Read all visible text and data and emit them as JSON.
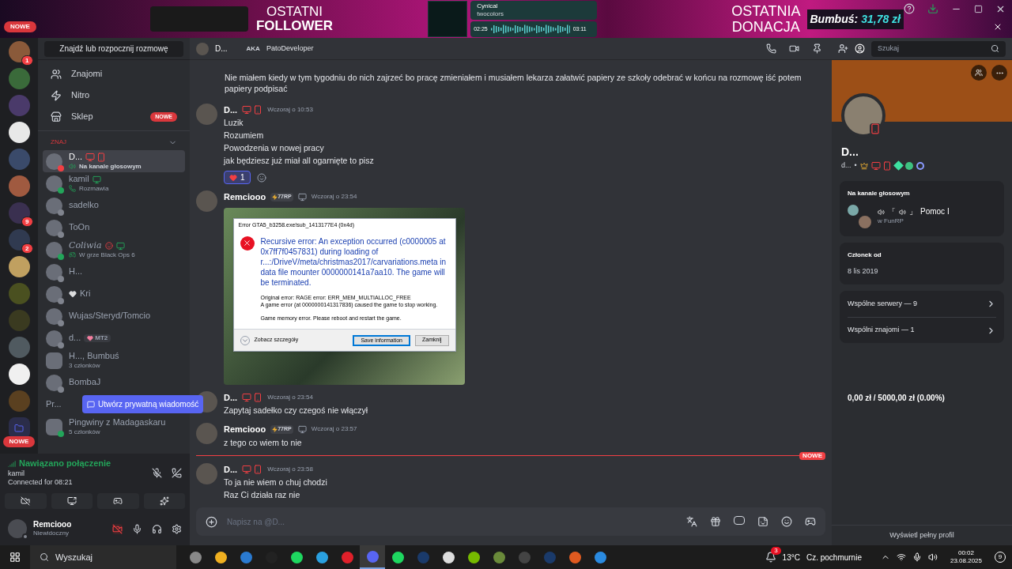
{
  "overlay": {
    "follower_top": "OSTATNI",
    "follower_bottom": "FOLLOWER",
    "track": {
      "title": "Cynical",
      "artist": "twocolors",
      "elapsed": "02:25",
      "total": "03:11"
    },
    "donation_top": "OSTATNIA",
    "donation_bottom": "DONACJA",
    "donor": "Bumbuś:",
    "amount": "31,78 zł"
  },
  "notice": {
    "badge": "NOWE"
  },
  "server_rail": {
    "servers": [
      {
        "badge": "1",
        "color": "#8a5a3a"
      },
      {
        "color": "#3a6a3a"
      },
      {
        "color": "#4a3a6a"
      },
      {
        "color": "#e8e8e8"
      },
      {
        "color": "#3a4a6a"
      },
      {
        "color": "#a05a40"
      },
      {
        "badge": "9",
        "color": "#3a3050"
      },
      {
        "badge": "2",
        "color": "#303a50"
      },
      {
        "color": "#c0a060"
      },
      {
        "color": "#4a5020"
      },
      {
        "color": "#3a3a20"
      },
      {
        "color": "#505a60"
      },
      {
        "color": "#f0f0f0"
      },
      {
        "color": "#5a4020"
      }
    ],
    "folder_badge": "NOWE"
  },
  "dm_sidebar": {
    "search": "Znajdź lub rozpocznij rozmowę",
    "nav": [
      {
        "label": "Znajomi"
      },
      {
        "label": "Nitro"
      },
      {
        "label": "Sklep",
        "badge": "NOWE"
      }
    ],
    "section": "ZNAJ",
    "dms": [
      {
        "kind": "voice",
        "name": "D...",
        "status": "Na kanale głosowym",
        "color": "#f23f43",
        "devices": true,
        "selected": true
      },
      {
        "kind": "call",
        "name": "kamil",
        "status": "Rozmawia",
        "color": "#23a55a",
        "desktop": true,
        "selected": false
      },
      {
        "kind": "plain",
        "name": "sadelko",
        "color": "#80848e",
        "selected": false
      },
      {
        "kind": "plain",
        "name": "ToOn",
        "color": "#80848e",
        "selected": false
      },
      {
        "kind": "game",
        "name": "Coliwia",
        "status": "W grze Black Ops 6",
        "color": "#23a55a",
        "desktop": true,
        "devil": true,
        "selected": false
      },
      {
        "kind": "plain",
        "name": "H...",
        "color": "#80848e",
        "selected": false
      },
      {
        "kind": "plain",
        "name": "Kri",
        "heart": true,
        "color": "#80848e",
        "selected": false
      },
      {
        "kind": "plain",
        "name": "Wujas/Steryd/Tomcio",
        "color": "#80848e",
        "selected": false
      },
      {
        "kind": "plain",
        "name": "d...",
        "tag": "MT2",
        "color": "#80848e",
        "selected": false
      },
      {
        "kind": "group",
        "name": "H..., Bumbuś",
        "status": "3 członków",
        "selected": false
      },
      {
        "kind": "plain",
        "name": "BombaJ",
        "color": "#80848e",
        "selected": false
      },
      {
        "kind": "tooltip",
        "name": "Pr...",
        "tooltip": "Utwórz prywatną wiadomość",
        "selected": false
      },
      {
        "kind": "group",
        "name": "Pingwiny z Madagaskaru",
        "status": "5 członków",
        "color": "#23a55a",
        "selected": false
      }
    ]
  },
  "voice_panel": {
    "status": "Nawiązano połączenie",
    "channel": "kamil",
    "timer": "Connected for 08:21"
  },
  "user_panel": {
    "name": "Remciooo",
    "status": "Niewidoczny",
    "muted_camera": true
  },
  "chat": {
    "header": {
      "name": "D...",
      "aka": "AKA",
      "nickname": "PatoDeveloper",
      "placeholder": "Szukaj"
    },
    "messages": [
      {
        "kind": "continued",
        "lines": [
          "Nie miałem kiedy w tym tygodniu do nich zajrzeć bo pracę zmieniałem i musiałem lekarza załatwić papiery ze szkoły odebrać w końcu na rozmowę iść potem papiery podpisać"
        ]
      },
      {
        "kind": "text",
        "author": "D...",
        "devices": true,
        "time": "Wczoraj o 10:53",
        "lines": [
          "Luzik",
          "Rozumiem",
          "Powodzenia w nowej pracy",
          "jak będziesz już miał all ogarnięte to pisz"
        ],
        "reaction": {
          "count": "1",
          "selected": true
        }
      },
      {
        "kind": "image",
        "author": "Remciooo",
        "tag": "77RP",
        "time": "Wczoraj o 23:54",
        "dialog": {
          "title": "Error GTA5_b3258.exe!sub_1413177E4 (0x4d)",
          "main": "Recursive error: An exception occurred (c0000005 at 0x7ff7f0457831) during loading of r...:/DriveV/meta/christmas2017/carvariations.meta in data file mounter 0000000141a7aa10. The game will be terminated.",
          "details": [
            "Original error: RAGE error: ERR_MEM_MULTIALLOC_FREE",
            "A game error (at 0000000141317836) caused the game to stop working."
          ],
          "footer": "Game memory error. Please reboot and restart the game.",
          "expand": "Zobacz szczegóły",
          "buttons": [
            {
              "label": "Save information",
              "selected": true
            },
            {
              "label": "Zamknij",
              "selected": false
            }
          ]
        }
      },
      {
        "kind": "text",
        "author": "D...",
        "devices": true,
        "time": "Wczoraj o 23:54",
        "lines": [
          "Zapytaj sadełko czy czegoś nie włączył"
        ]
      },
      {
        "kind": "text",
        "author": "Remciooo",
        "tag": "77RP",
        "time": "Wczoraj o 23:57",
        "lines": [
          "z tego co wiem to nie"
        ]
      },
      {
        "kind": "divider",
        "badge": "NOWE"
      },
      {
        "kind": "text",
        "author": "D...",
        "devices": true,
        "time": "Wczoraj o 23:58",
        "lines": [
          "To ja nie wiem o chuj chodzi",
          "Raz Ci działa raz nie"
        ]
      }
    ],
    "input": {
      "placeholder": "Napisz na @D..."
    }
  },
  "profile": {
    "name": "D...",
    "username": "d...",
    "separator": "•",
    "voice": {
      "heading": "Na kanale głosowym",
      "open": "「",
      "close": "」",
      "channel": "Pomoc I",
      "server": "w FunRP"
    },
    "member": {
      "heading": "Członek od",
      "date": "8 lis 2019"
    },
    "links": [
      "Wspólne serwery — 9",
      "Wspólni znajomi — 1"
    ],
    "goal": "0,00 zł / 5000,00 zł (0.00%)",
    "footer": "Wyświetl pełny profil"
  },
  "taskbar": {
    "placeholder": "Wyszukaj",
    "apps": [
      {
        "selected": false
      },
      {
        "selected": false
      },
      {
        "selected": false
      },
      {
        "selected": false
      },
      {
        "selected": false
      },
      {
        "selected": false
      },
      {
        "selected": false
      },
      {
        "selected": true
      },
      {
        "selected": false
      },
      {
        "selected": false
      },
      {
        "selected": false
      },
      {
        "selected": false
      },
      {
        "selected": false
      },
      {
        "selected": false
      },
      {
        "selected": false
      },
      {
        "selected": false
      },
      {
        "selected": false
      }
    ],
    "weather_badge": "3",
    "temperature": "13°C",
    "weather": "Cz. pochmurnie",
    "time": "00:02",
    "date": "23.08.2025",
    "notifications": "9"
  }
}
